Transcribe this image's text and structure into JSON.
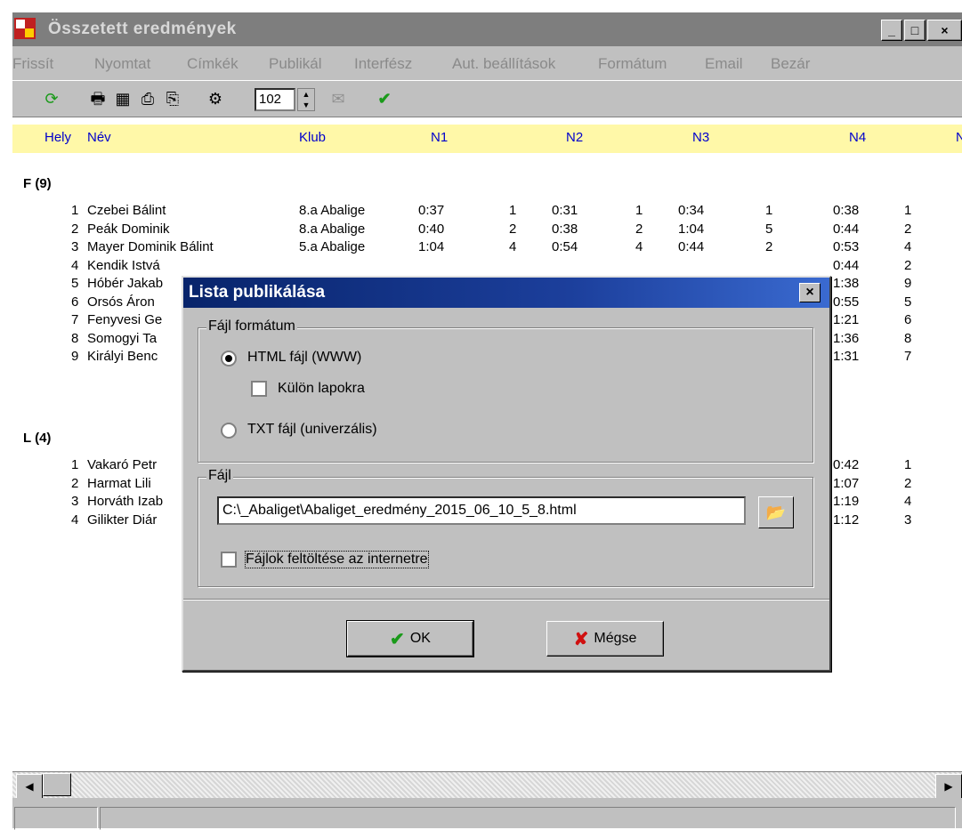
{
  "window": {
    "title": "Összetett eredmények"
  },
  "menu": [
    "Frissít",
    "Nyomtat",
    "Címkék",
    "Publikál",
    "Interfész",
    "Aut. beállítások",
    "Formátum",
    "Email",
    "Bezár"
  ],
  "toolbar": {
    "spin_value": "102"
  },
  "columns": [
    "Hely",
    "Név",
    "Klub",
    "N1",
    "N2",
    "N3",
    "N4",
    "N"
  ],
  "groups": [
    {
      "label": "F",
      "count": "(9)"
    },
    {
      "label": "L",
      "count": "(4)"
    }
  ],
  "rows_f": [
    {
      "place": "1",
      "name": "Czebei Bálint",
      "club": "8.a Abalige",
      "n1": "0:37",
      "p1": "1",
      "n2": "0:31",
      "p2": "1",
      "n3": "0:34",
      "p3": "1",
      "n4": "0:38",
      "p4": "1"
    },
    {
      "place": "2",
      "name": "Peák Dominik",
      "club": "8.a Abalige",
      "n1": "0:40",
      "p1": "2",
      "n2": "0:38",
      "p2": "2",
      "n3": "1:04",
      "p3": "5",
      "n4": "0:44",
      "p4": "2"
    },
    {
      "place": "3",
      "name": "Mayer Dominik Bálint",
      "club": "5.a Abalige",
      "n1": "1:04",
      "p1": "4",
      "n2": "0:54",
      "p2": "4",
      "n3": "0:44",
      "p3": "2",
      "n4": "0:53",
      "p4": "4"
    },
    {
      "place": "4",
      "name": "Kendik Istvá",
      "club": "",
      "n1": "",
      "p1": "",
      "n2": "",
      "p2": "",
      "n3": "",
      "p3": "",
      "n4": "0:44",
      "p4": "2"
    },
    {
      "place": "5",
      "name": "Hóbér Jakab",
      "club": "",
      "n1": "",
      "p1": "",
      "n2": "",
      "p2": "",
      "n3": "",
      "p3": "",
      "n4": "1:38",
      "p4": "9"
    },
    {
      "place": "6",
      "name": "Orsós Áron",
      "club": "",
      "n1": "",
      "p1": "",
      "n2": "",
      "p2": "",
      "n3": "",
      "p3": "",
      "n4": "0:55",
      "p4": "5"
    },
    {
      "place": "7",
      "name": "Fenyvesi Ge",
      "club": "",
      "n1": "",
      "p1": "",
      "n2": "",
      "p2": "",
      "n3": "",
      "p3": "",
      "n4": "1:21",
      "p4": "6"
    },
    {
      "place": "8",
      "name": "Somogyi Ta",
      "club": "",
      "n1": "",
      "p1": "",
      "n2": "",
      "p2": "",
      "n3": "",
      "p3": "",
      "n4": "1:36",
      "p4": "8"
    },
    {
      "place": "9",
      "name": "Királyi Benc",
      "club": "",
      "n1": "",
      "p1": "",
      "n2": "",
      "p2": "",
      "n3": "",
      "p3": "",
      "n4": "1:31",
      "p4": "7"
    }
  ],
  "rows_l": [
    {
      "place": "1",
      "name": "Vakaró Petr",
      "n4": "0:42",
      "p4": "1"
    },
    {
      "place": "2",
      "name": "Harmat Lili",
      "n4": "1:07",
      "p4": "2"
    },
    {
      "place": "3",
      "name": "Horváth Izab",
      "n4": "1:19",
      "p4": "4"
    },
    {
      "place": "4",
      "name": "Gilikter Diár",
      "n4": "1:12",
      "p4": "3"
    }
  ],
  "dialog": {
    "title": "Lista publikálása",
    "format_legend": "Fájl formátum",
    "html_option": "HTML fájl (WWW)",
    "separate_pages": "Külön lapokra",
    "txt_option": "TXT fájl (univerzális)",
    "file_legend": "Fájl",
    "path": "C:\\_Abaliget\\Abaliget_eredmény_2015_06_10_5_8.html",
    "upload_label": "Fájlok feltöltése az internetre",
    "ok_label": "OK",
    "cancel_label": "Mégse"
  },
  "colors": {
    "header_bg": "#fff8a8",
    "header_text": "#0000cc",
    "dialog_title": "#08246b",
    "ok_check": "#1a9a1a",
    "cancel_x": "#d01010"
  }
}
